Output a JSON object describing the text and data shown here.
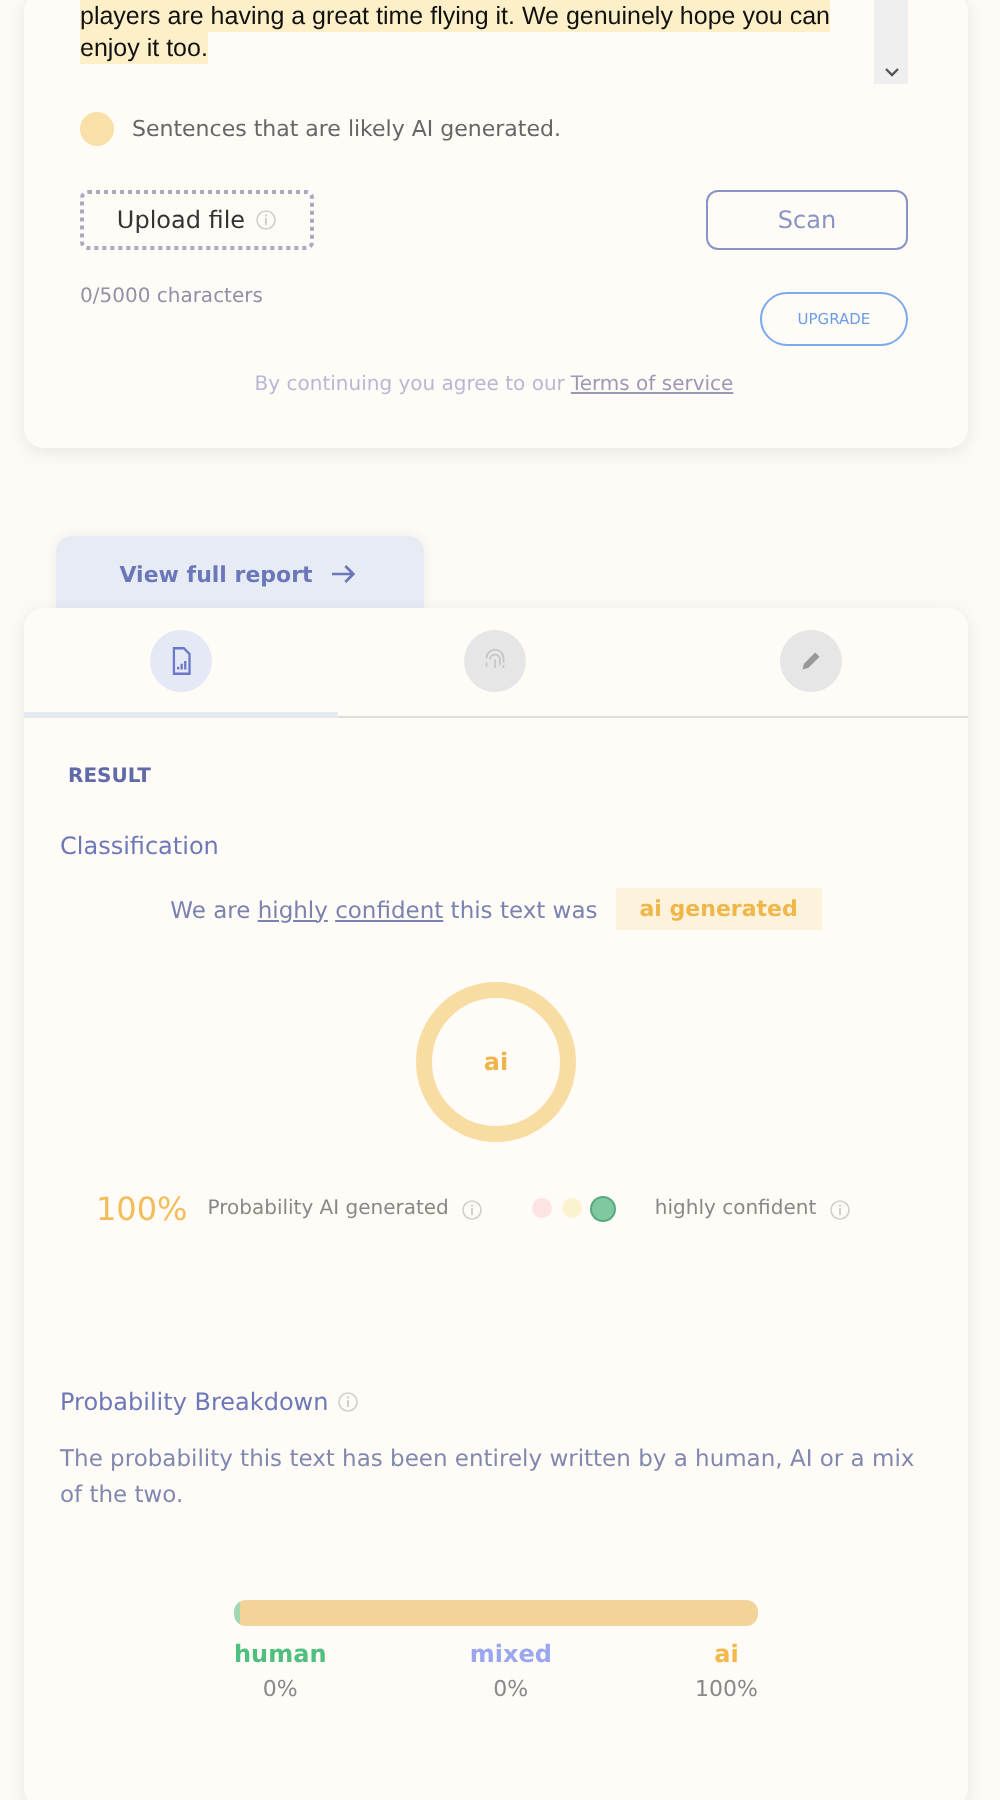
{
  "input": {
    "lines": [
      "players are having a great time flying it. We genuinely hope you can",
      "enjoy it too."
    ]
  },
  "legend": {
    "label": "Sentences that are likely AI generated.",
    "color": "#f8e0a8"
  },
  "upload_button": {
    "label": "Upload file"
  },
  "scan_button": {
    "label": "Scan"
  },
  "char_count": "0/5000 characters",
  "upgrade_button": {
    "label": "UPGRADE"
  },
  "terms": {
    "text": "By continuing you agree to our",
    "link": "Terms of service"
  },
  "report_link": {
    "label": "View full report"
  },
  "tabs": [
    {
      "kind": "report",
      "selected": true
    },
    {
      "kind": "fingerprint",
      "selected": false
    },
    {
      "kind": "pencil",
      "selected": false
    }
  ],
  "result": {
    "heading": "RESULT",
    "classification_title": "Classification",
    "sentence": {
      "before": "We are",
      "underlined_words": [
        "highly",
        "confident"
      ],
      "after": "this text was"
    },
    "verdict": "ai generated",
    "ring_label": "ai",
    "percent": "100%",
    "probability_label": "Probability AI generated",
    "confidence_dots": [
      {
        "color": "#fde3e3",
        "selected": false
      },
      {
        "color": "#fbf3cf",
        "selected": false
      },
      {
        "color": "#7fc8a0",
        "selected": true
      }
    ],
    "confidence_label": "highly confident"
  },
  "breakdown": {
    "title": "Probability Breakdown",
    "description": "The probability this text has been entirely written by a human, AI or a mix of the two.",
    "segments": [
      {
        "label": "human",
        "value": "0%",
        "level": 0.01,
        "color": "#4fbf7f"
      },
      {
        "label": "mixed",
        "value": "0%",
        "color": "#9aa6f0"
      },
      {
        "label": "ai",
        "value": "100%",
        "level": 0.99,
        "color": "#f2b84b"
      }
    ]
  }
}
